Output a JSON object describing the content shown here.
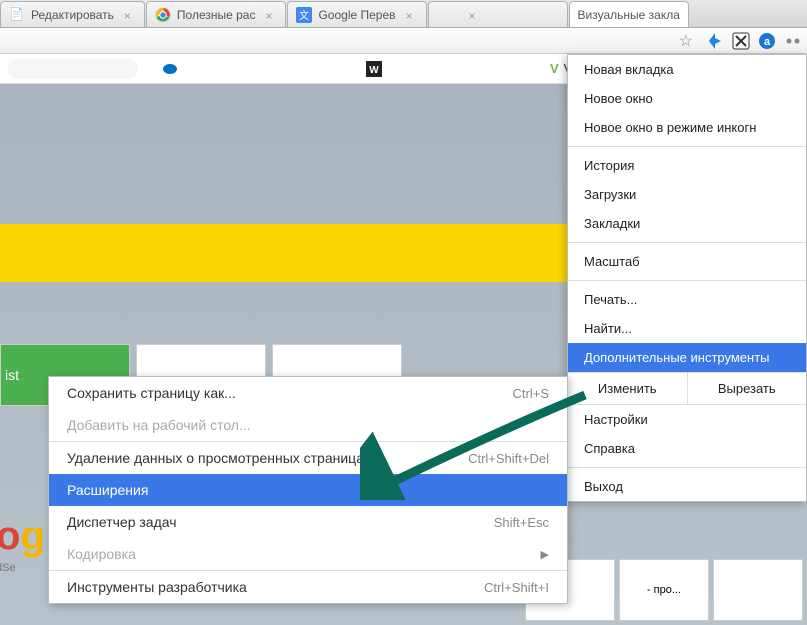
{
  "tabs": [
    {
      "label": "Редактировать",
      "close": "×"
    },
    {
      "label": "Полезные рас",
      "close": "×"
    },
    {
      "label": "Google Перев",
      "close": "×"
    },
    {
      "label": "",
      "close": "×"
    },
    {
      "label": "Визуальные закла",
      "close": ""
    }
  ],
  "bookmarks": {
    "vm": "VM"
  },
  "mainMenu": {
    "newTab": "Новая вкладка",
    "newWindow": "Новое окно",
    "newIncognito": "Новое окно в режиме инкогн",
    "history": "История",
    "downloads": "Загрузки",
    "bookmarks": "Закладки",
    "zoom": "Масштаб",
    "print": "Печать...",
    "find": "Найти...",
    "moreTools": "Дополнительные инструменты",
    "editLabel": "Изменить",
    "cut": "Вырезать",
    "settings": "Настройки",
    "help": "Справка",
    "exit": "Выход"
  },
  "subMenu": {
    "savePage": {
      "label": "Сохранить страницу как...",
      "shortcut": "Ctrl+S"
    },
    "addToDesktop": {
      "label": "Добавить на рабочий стол..."
    },
    "clearData": {
      "label": "Удаление данных о просмотренных страницах...",
      "shortcut": "Ctrl+Shift+Del"
    },
    "extensions": {
      "label": "Расширения"
    },
    "taskManager": {
      "label": "Диспетчер задач",
      "shortcut": "Shift+Esc"
    },
    "encoding": {
      "label": "Кодировка"
    },
    "devTools": {
      "label": "Инструменты разработчика",
      "shortcut": "Ctrl+Shift+I"
    }
  },
  "content": {
    "ist": "ist",
    "pro": "- про..."
  }
}
